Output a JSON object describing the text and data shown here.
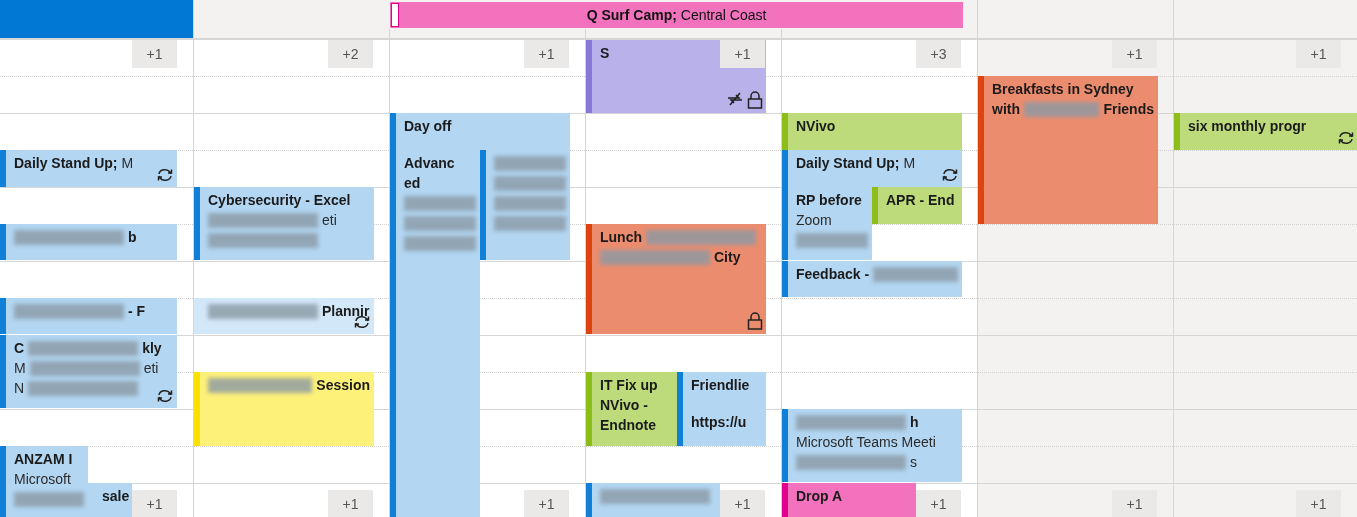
{
  "all_day_event": {
    "title": "Q Surf Camp;",
    "location": "Central Coast",
    "color": "#f272bd"
  },
  "days": [
    {
      "selected": true,
      "non_working": false,
      "more_top": "+1",
      "more_bottom": "+1",
      "events": [
        {
          "color": "#b3d6f2",
          "recurring": true,
          "private": false,
          "locked": false,
          "tentative": false,
          "lines": [
            [
              {
                "kind": "bold",
                "text": "Daily Stand Up;"
              },
              {
                "kind": "plain",
                "text": "M"
              }
            ]
          ]
        },
        {
          "color": "#b3d6f2",
          "recurring": false,
          "private": false,
          "locked": false,
          "tentative": false,
          "lines": [
            [
              {
                "kind": "blur"
              },
              {
                "kind": "bold",
                "text": "b"
              }
            ]
          ]
        },
        {
          "color": "#b3d6f2",
          "recurring": false,
          "private": false,
          "locked": false,
          "tentative": false,
          "lines": [
            [
              {
                "kind": "blur"
              },
              {
                "kind": "bold",
                "text": "- F"
              }
            ]
          ]
        },
        {
          "color": "#b3d6f2",
          "recurring": true,
          "private": false,
          "locked": false,
          "tentative": false,
          "lines": [
            [
              {
                "kind": "bold",
                "text": "C"
              },
              {
                "kind": "blur"
              },
              {
                "kind": "bold",
                "text": "kly"
              }
            ],
            [
              {
                "kind": "plain",
                "text": "M"
              },
              {
                "kind": "blur"
              },
              {
                "kind": "plain",
                "text": "eti"
              }
            ],
            [
              {
                "kind": "plain",
                "text": "N"
              },
              {
                "kind": "blur"
              }
            ]
          ]
        },
        {
          "color": "#b3d6f2",
          "recurring": false,
          "private": false,
          "locked": false,
          "tentative": false,
          "lines": [
            [
              {
                "kind": "bold",
                "text": "ANZAM I"
              }
            ],
            [
              {
                "kind": "plain",
                "text": "Microsoft"
              }
            ],
            [
              {
                "kind": "blur"
              }
            ]
          ]
        },
        {
          "color": "#b3d6f2",
          "recurring": false,
          "private": false,
          "locked": false,
          "tentative": true,
          "lines": [
            [
              {
                "kind": "bold",
                "text": "sale"
              }
            ]
          ]
        }
      ]
    },
    {
      "selected": false,
      "non_working": false,
      "more_top": "+2",
      "more_bottom": "+1",
      "events": [
        {
          "color": "#b3d6f2",
          "recurring": false,
          "private": false,
          "locked": false,
          "tentative": false,
          "lines": [
            [
              {
                "kind": "bold",
                "text": "Cybersecurity - Excel"
              }
            ],
            [
              {
                "kind": "blur"
              },
              {
                "kind": "plain",
                "text": "eti"
              }
            ],
            [
              {
                "kind": "blur"
              }
            ]
          ]
        },
        {
          "color": "#d2e7f8",
          "recurring": true,
          "private": false,
          "locked": false,
          "tentative": true,
          "lines": [
            [
              {
                "kind": "blur"
              },
              {
                "kind": "bold",
                "text": "Plannir"
              }
            ]
          ]
        },
        {
          "color": "#fef17a",
          "recurring": false,
          "private": false,
          "locked": false,
          "tentative": false,
          "lines": [
            [
              {
                "kind": "blur"
              },
              {
                "kind": "bold",
                "text": "Session"
              }
            ]
          ]
        }
      ]
    },
    {
      "selected": false,
      "non_working": false,
      "more_top": "+1",
      "more_bottom": "+1",
      "events": [
        {
          "color": "#b3d6f2",
          "recurring": false,
          "private": false,
          "locked": false,
          "tentative": false,
          "lines": [
            [
              {
                "kind": "bold",
                "text": "Day off"
              }
            ]
          ]
        },
        {
          "color": "#b3d6f2",
          "recurring": false,
          "private": false,
          "locked": false,
          "tentative": false,
          "lines": [
            [
              {
                "kind": "bold",
                "text": "Advanc"
              }
            ],
            [
              {
                "kind": "bold",
                "text": "ed"
              }
            ],
            [
              {
                "kind": "blur"
              }
            ],
            [
              {
                "kind": "blur"
              }
            ],
            [
              {
                "kind": "blur"
              }
            ]
          ]
        },
        {
          "color": "#b3d6f2",
          "recurring": false,
          "private": false,
          "locked": false,
          "tentative": false,
          "lines": [
            [
              {
                "kind": "blur"
              }
            ],
            [
              {
                "kind": "blur"
              }
            ],
            [
              {
                "kind": "blur"
              }
            ],
            [
              {
                "kind": "blur"
              }
            ]
          ]
        }
      ]
    },
    {
      "selected": false,
      "non_working": false,
      "more_top": "+1",
      "more_bottom": "+1",
      "events": [
        {
          "color": "#b9b1ea",
          "recurring": false,
          "private": true,
          "locked": true,
          "tentative": false,
          "lines": [
            [
              {
                "kind": "bold",
                "text": "S"
              }
            ]
          ]
        },
        {
          "color": "#ec8c6e",
          "recurring": false,
          "private": false,
          "locked": true,
          "tentative": false,
          "lines": [
            [
              {
                "kind": "bold",
                "text": "Lunch"
              },
              {
                "kind": "blur"
              }
            ],
            [
              {
                "kind": "blur"
              },
              {
                "kind": "bold",
                "text": "City"
              }
            ]
          ]
        },
        {
          "color": "#bddb7a",
          "recurring": false,
          "private": false,
          "locked": false,
          "tentative": false,
          "lines": [
            [
              {
                "kind": "bold",
                "text": "IT Fix up"
              }
            ],
            [
              {
                "kind": "bold",
                "text": "NVivo -"
              }
            ],
            [
              {
                "kind": "bold",
                "text": "Endnote"
              }
            ]
          ]
        },
        {
          "color": "#b3d6f2",
          "recurring": false,
          "private": false,
          "locked": false,
          "tentative": false,
          "lines": [
            [
              {
                "kind": "bold",
                "text": "Friendlie"
              }
            ]
          ]
        },
        {
          "color": "#b3d6f2",
          "recurring": false,
          "private": false,
          "locked": false,
          "tentative": false,
          "lines": [
            [
              {
                "kind": "bold",
                "text": "https://u"
              }
            ]
          ]
        },
        {
          "color": "#b3d6f2",
          "recurring": false,
          "private": false,
          "locked": false,
          "tentative": false,
          "lines": [
            [
              {
                "kind": "blur"
              }
            ]
          ]
        }
      ]
    },
    {
      "selected": false,
      "non_working": false,
      "more_top": "+3",
      "more_bottom": "+1",
      "events": [
        {
          "color": "#bddb7a",
          "recurring": false,
          "private": false,
          "locked": false,
          "tentative": false,
          "lines": [
            [
              {
                "kind": "bold",
                "text": "NVivo"
              }
            ]
          ]
        },
        {
          "color": "#b3d6f2",
          "recurring": true,
          "private": false,
          "locked": false,
          "tentative": false,
          "lines": [
            [
              {
                "kind": "bold",
                "text": "Daily Stand Up;"
              },
              {
                "kind": "plain",
                "text": "M"
              }
            ]
          ]
        },
        {
          "color": "#b3d6f2",
          "recurring": false,
          "private": false,
          "locked": false,
          "tentative": false,
          "lines": [
            [
              {
                "kind": "bold",
                "text": "RP before"
              }
            ],
            [
              {
                "kind": "plain",
                "text": "Zoom"
              }
            ],
            [
              {
                "kind": "blur"
              }
            ]
          ]
        },
        {
          "color": "#bddb7a",
          "recurring": false,
          "private": false,
          "locked": false,
          "tentative": false,
          "lines": [
            [
              {
                "kind": "bold",
                "text": "APR - End"
              }
            ]
          ]
        },
        {
          "color": "#b3d6f2",
          "recurring": false,
          "private": false,
          "locked": false,
          "tentative": false,
          "lines": [
            [
              {
                "kind": "bold",
                "text": "Feedback -"
              },
              {
                "kind": "blur"
              }
            ]
          ]
        },
        {
          "color": "#b3d6f2",
          "recurring": false,
          "private": false,
          "locked": false,
          "tentative": false,
          "lines": [
            [
              {
                "kind": "blur"
              },
              {
                "kind": "bold",
                "text": "h"
              }
            ],
            [
              {
                "kind": "plain",
                "text": "Microsoft Teams Meeti"
              }
            ],
            [
              {
                "kind": "blur"
              },
              {
                "kind": "plain",
                "text": "s"
              }
            ]
          ]
        },
        {
          "color": "#f272bd",
          "recurring": false,
          "private": false,
          "locked": false,
          "tentative": false,
          "lines": [
            [
              {
                "kind": "bold",
                "text": "Drop A"
              }
            ]
          ]
        }
      ]
    },
    {
      "selected": false,
      "non_working": true,
      "more_top": "+1",
      "more_bottom": "+1",
      "events": [
        {
          "color": "#ec8c6e",
          "recurring": false,
          "private": false,
          "locked": false,
          "tentative": false,
          "lines": [
            [
              {
                "kind": "bold",
                "text": "Breakfasts in Sydney"
              }
            ],
            [
              {
                "kind": "bold",
                "text": "with"
              },
              {
                "kind": "blur"
              },
              {
                "kind": "bold",
                "text": "Friends"
              }
            ]
          ]
        }
      ]
    },
    {
      "selected": false,
      "non_working": true,
      "more_top": "+1",
      "more_bottom": "+1",
      "events": [
        {
          "color": "#bddb7a",
          "recurring": true,
          "private": false,
          "locked": false,
          "tentative": false,
          "lines": [
            [
              {
                "kind": "bold",
                "text": "six monthly progr"
              }
            ]
          ]
        }
      ]
    }
  ]
}
